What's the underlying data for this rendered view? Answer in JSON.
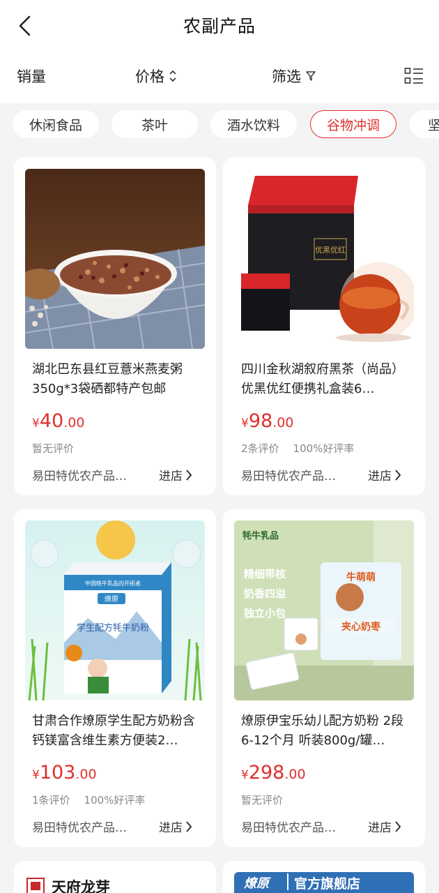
{
  "header": {
    "title": "农副产品"
  },
  "sortbar": {
    "sales": "销量",
    "price": "价格",
    "filter": "筛选"
  },
  "chips": [
    "休闲食品",
    "茶叶",
    "酒水饮料",
    "谷物冲调",
    "坚"
  ],
  "products": [
    {
      "name": "湖北巴东县红豆薏米燕麦粥350g*3袋硒都特产包邮",
      "currency": "¥",
      "price_int": "40",
      "price_dec": ".00",
      "review": "暂无评价",
      "rate": "",
      "shop": "易田特优农产品…",
      "enter": "进店"
    },
    {
      "name": "四川金秋湖叙府黑茶（尚品）优黑优红便携礼盒装6…",
      "currency": "¥",
      "price_int": "98",
      "price_dec": ".00",
      "review": "2条评价",
      "rate": "100%好评率",
      "shop": "易田特优农产品…",
      "enter": "进店"
    },
    {
      "name": "甘肃合作燎原学生配方奶粉含钙镁富含维生素方便装2…",
      "currency": "¥",
      "price_int": "103",
      "price_dec": ".00",
      "review": "1条评价",
      "rate": "100%好评率",
      "shop": "易田特优农产品…",
      "enter": "进店"
    },
    {
      "name": "燎原伊宝乐幼儿配方奶粉 2段6-12个月 听装800g/罐…",
      "currency": "¥",
      "price_int": "298",
      "price_dec": ".00",
      "review": "暂无评价",
      "rate": "",
      "shop": "易田特优农产品…",
      "enter": "进店"
    }
  ],
  "images": {
    "p2_brand": "优黑优红",
    "p3_brand": "学生配方牦牛奶粉",
    "p3_top": "中国牦牛乳品的开拓者",
    "p3_logo": "燎原",
    "p4_brand": "牦牛乳品",
    "p4_lines": [
      "精细带核",
      "奶香四溢",
      "独立小包"
    ],
    "p4_box": "夹心奶枣",
    "p4_box_top": "牛萌萌",
    "p5_brand": "天府龙芽",
    "p6_brand": "燎原",
    "p6_text": "官方旗舰店"
  },
  "colors": {
    "accent": "#e0302c",
    "background": "#f4f4f4"
  }
}
